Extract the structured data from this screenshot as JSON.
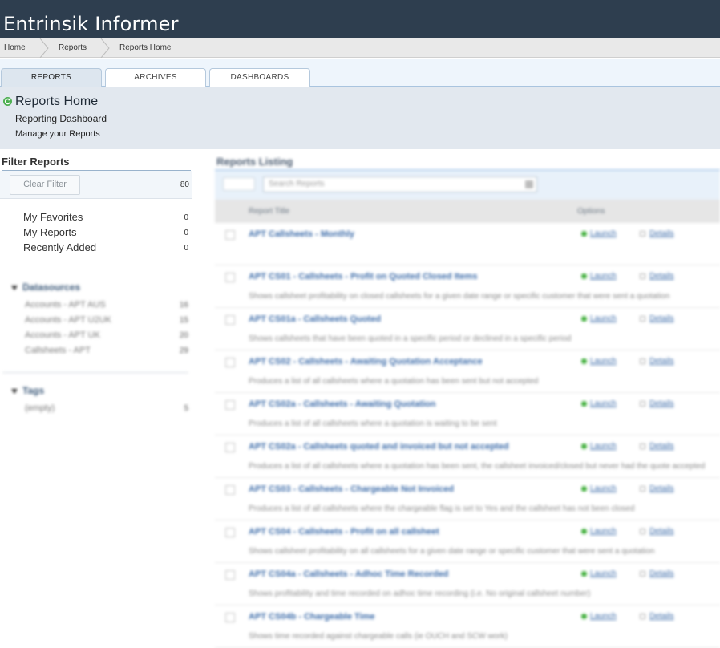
{
  "app": {
    "title": "Entrinsik Informer"
  },
  "breadcrumb": [
    "Home",
    "Reports",
    "Reports Home"
  ],
  "tabs": [
    "REPORTS",
    "ARCHIVES",
    "DASHBOARDS"
  ],
  "hero": {
    "title": "Reports Home",
    "subtitle": "Reporting Dashboard",
    "subtitle2": "Manage your Reports"
  },
  "sidebar": {
    "title": "Filter Reports",
    "clear_label": "Clear Filter",
    "total": "80",
    "quick": [
      {
        "label": "My Favorites",
        "count": "0"
      },
      {
        "label": "My Reports",
        "count": "0"
      },
      {
        "label": "Recently Added",
        "count": "0"
      }
    ],
    "datasources": {
      "label": "Datasources",
      "items": [
        {
          "label": "Accounts - APT AUS",
          "count": "16"
        },
        {
          "label": "Accounts - APT U2UK",
          "count": "15"
        },
        {
          "label": "Accounts - APT UK",
          "count": "20"
        },
        {
          "label": "Callsheets - APT",
          "count": "29"
        }
      ]
    },
    "tags": {
      "label": "Tags",
      "items": [
        {
          "label": "(empty)",
          "count": "5"
        }
      ]
    }
  },
  "main": {
    "title": "Reports Listing",
    "search_placeholder": "Search Reports",
    "col_title": "Report Title",
    "col_options": "Options",
    "launch_label": "Launch",
    "details_label": "Details",
    "rows": [
      {
        "title": "APT Callsheets - Monthly",
        "desc": ""
      },
      {
        "title": "APT CS01 - Callsheets - Profit on Quoted Closed Items",
        "desc": "Shows callsheet profitability on closed callsheets for a given date range or specific customer that were sent a quotation"
      },
      {
        "title": "APT CS01a - Callsheets Quoted",
        "desc": "Shows callsheets that have been quoted in a specific period or declined in a specific period"
      },
      {
        "title": "APT CS02 - Callsheets - Awaiting Quotation Acceptance",
        "desc": "Produces a list of all callsheets where a quotation has been sent but not accepted"
      },
      {
        "title": "APT CS02a - Callsheets - Awaiting Quotation",
        "desc": "Produces a list of all callsheets where a quotation is waiting to be sent"
      },
      {
        "title": "APT CS02a - Callsheets quoted and invoiced but not accepted",
        "desc": "Produces a list of all callsheets where a quotation has been sent, the callsheet invoiced/closed but never had the quote accepted"
      },
      {
        "title": "APT CS03 - Callsheets - Chargeable Not Invoiced",
        "desc": "Produces a list of all callsheets where the chargeable flag is set to Yes and the callsheet has not been closed"
      },
      {
        "title": "APT CS04 - Callsheets - Profit on all callsheet",
        "desc": "Shows callsheet profitability on all callsheets for a given date range or specific customer that were sent a quotation"
      },
      {
        "title": "APT CS04a - Callsheets - Adhoc Time Recorded",
        "desc": "Shows profitability and time recorded on adhoc time recording (i.e. No original callsheet number)"
      },
      {
        "title": "APT CS04b - Chargeable Time",
        "desc": "Shows time recorded against chargeable calls (ie OUCH and SCW work)"
      }
    ]
  },
  "colors": {
    "topbar": "#2e3e4f",
    "accent": "#3a6aa8",
    "launch": "#3fae3a"
  }
}
